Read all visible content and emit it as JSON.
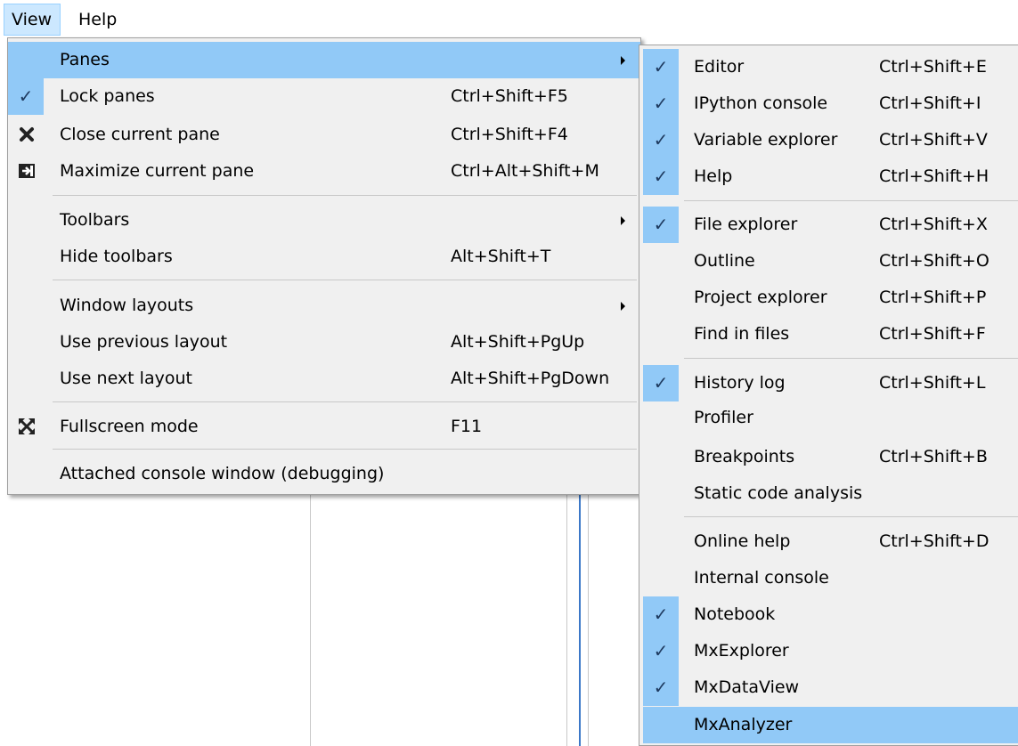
{
  "menubar": {
    "view": "View",
    "help": "Help"
  },
  "view_menu": {
    "items": [
      {
        "label": "Panes",
        "shortcut": ""
      },
      {
        "label": "Lock panes",
        "shortcut": "Ctrl+Shift+F5"
      },
      {
        "label": "Close current pane",
        "shortcut": "Ctrl+Shift+F4"
      },
      {
        "label": "Maximize current pane",
        "shortcut": "Ctrl+Alt+Shift+M"
      },
      {
        "label": "Toolbars",
        "shortcut": ""
      },
      {
        "label": "Hide toolbars",
        "shortcut": "Alt+Shift+T"
      },
      {
        "label": "Window layouts",
        "shortcut": ""
      },
      {
        "label": "Use previous layout",
        "shortcut": "Alt+Shift+PgUp"
      },
      {
        "label": "Use next layout",
        "shortcut": "Alt+Shift+PgDown"
      },
      {
        "label": "Fullscreen mode",
        "shortcut": "F11"
      },
      {
        "label": "Attached console window (debugging)",
        "shortcut": ""
      }
    ]
  },
  "panes_menu": {
    "items": [
      {
        "label": "Editor",
        "shortcut": "Ctrl+Shift+E",
        "checked": true
      },
      {
        "label": "IPython console",
        "shortcut": "Ctrl+Shift+I",
        "checked": true
      },
      {
        "label": "Variable explorer",
        "shortcut": "Ctrl+Shift+V",
        "checked": true
      },
      {
        "label": "Help",
        "shortcut": "Ctrl+Shift+H",
        "checked": true
      },
      {
        "label": "File explorer",
        "shortcut": "Ctrl+Shift+X",
        "checked": true
      },
      {
        "label": "Outline",
        "shortcut": "Ctrl+Shift+O",
        "checked": false
      },
      {
        "label": "Project explorer",
        "shortcut": "Ctrl+Shift+P",
        "checked": false
      },
      {
        "label": "Find in files",
        "shortcut": "Ctrl+Shift+F",
        "checked": false
      },
      {
        "label": "History log",
        "shortcut": "Ctrl+Shift+L",
        "checked": true
      },
      {
        "label": "Profiler",
        "shortcut": "",
        "checked": false
      },
      {
        "label": "Breakpoints",
        "shortcut": "Ctrl+Shift+B",
        "checked": false
      },
      {
        "label": "Static code analysis",
        "shortcut": "",
        "checked": false
      },
      {
        "label": "Online help",
        "shortcut": "Ctrl+Shift+D",
        "checked": false
      },
      {
        "label": "Internal console",
        "shortcut": "",
        "checked": false
      },
      {
        "label": "Notebook",
        "shortcut": "",
        "checked": true
      },
      {
        "label": "MxExplorer",
        "shortcut": "",
        "checked": true
      },
      {
        "label": "MxDataView",
        "shortcut": "",
        "checked": true
      },
      {
        "label": "MxAnalyzer",
        "shortcut": "",
        "checked": false
      }
    ]
  },
  "colors": {
    "highlight": "#91c9f7",
    "menu_bg": "#f0f0f0",
    "menubar_selected": "#cce8ff"
  }
}
